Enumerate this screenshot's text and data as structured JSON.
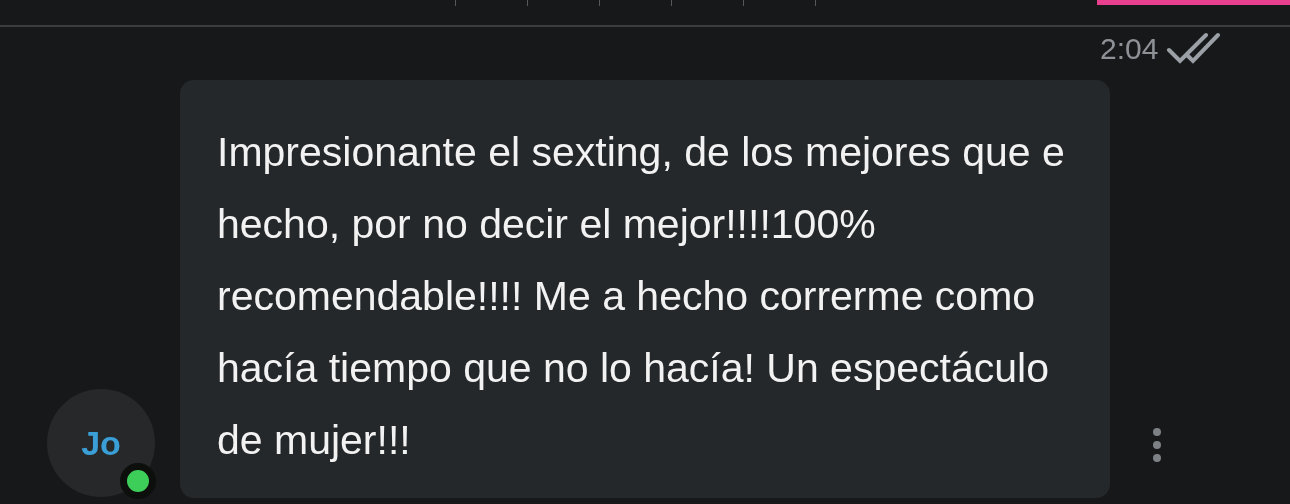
{
  "message": {
    "time": "2:04",
    "read": true,
    "text": "Impresionante el sexting, de los mejores que e hecho, por no decir el mejor!!!!100% recomendable!!!! Me a hecho correrme como hacía tiempo que no lo hacía! Un espectáculo de mujer!!!"
  },
  "sender": {
    "initials": "Jo",
    "online": true
  }
}
